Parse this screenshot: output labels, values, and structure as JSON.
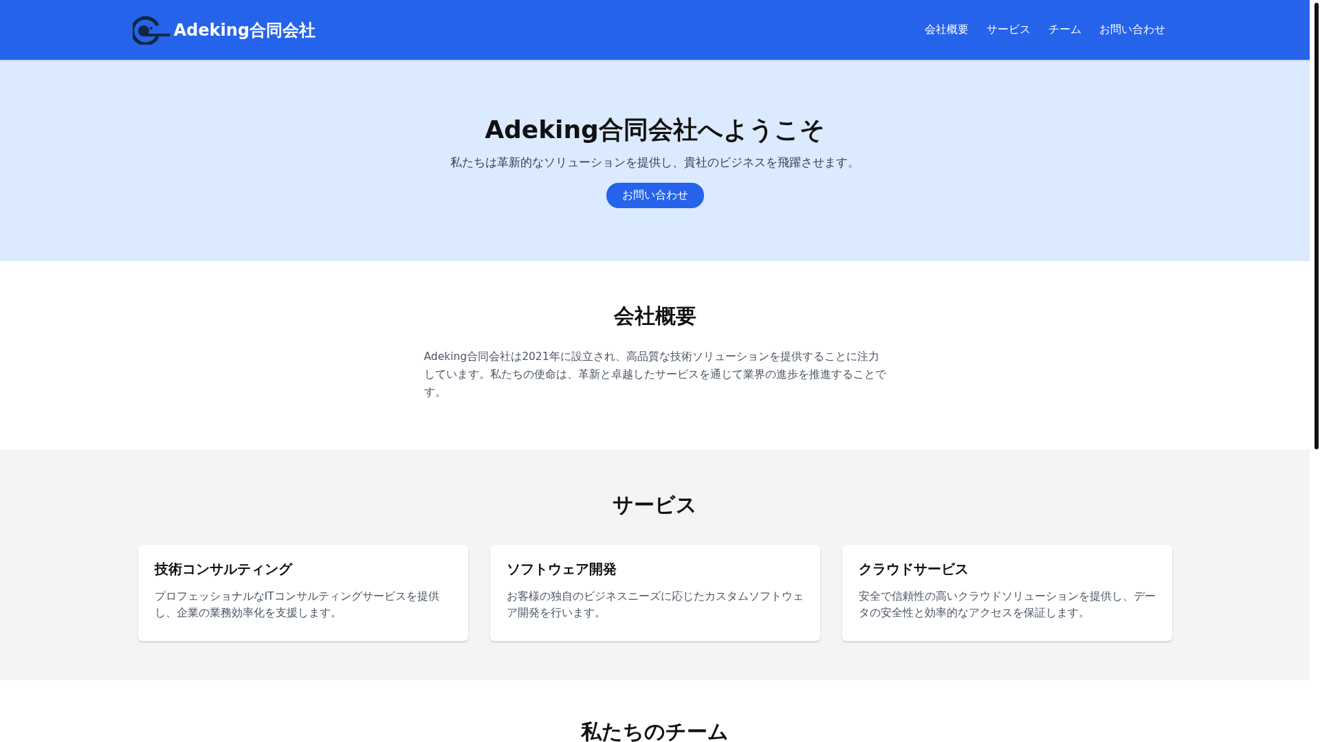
{
  "header": {
    "brand": "Adeking合同会社",
    "nav": [
      {
        "label": "会社概要"
      },
      {
        "label": "サービス"
      },
      {
        "label": "チーム"
      },
      {
        "label": "お問い合わせ"
      }
    ]
  },
  "hero": {
    "title": "Adeking合同会社へようこそ",
    "subtitle": "私たちは革新的なソリューションを提供し、貴社のビジネスを飛躍させます。",
    "button": "お問い合わせ"
  },
  "about": {
    "heading": "会社概要",
    "text": "Adeking合同会社は2021年に設立され、高品質な技術ソリューションを提供することに注力しています。私たちの使命は、革新と卓越したサービスを通じて業界の進歩を推進することです。"
  },
  "services": {
    "heading": "サービス",
    "cards": [
      {
        "title": "技術コンサルティング",
        "text": "プロフェッショナルなITコンサルティングサービスを提供し、企業の業務効率化を支援します。"
      },
      {
        "title": "ソフトウェア開発",
        "text": "お客様の独自のビジネスニーズに応じたカスタムソフトウェア開発を行います。"
      },
      {
        "title": "クラウドサービス",
        "text": "安全で信頼性の高いクラウドソリューションを提供し、データの安全性と効率的なアクセスを保証します。"
      }
    ]
  },
  "team": {
    "heading": "私たちのチーム"
  }
}
